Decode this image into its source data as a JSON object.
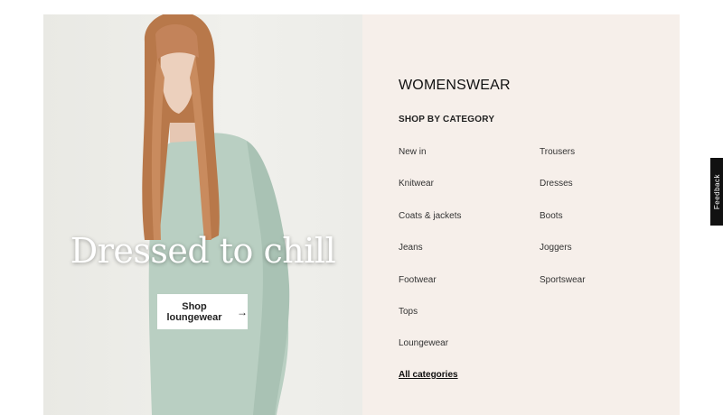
{
  "hero": {
    "title": "Dressed to chill",
    "button_label": "Shop loungewear",
    "button_icon": "arrow-right-icon"
  },
  "menu": {
    "title": "WOMENSWEAR",
    "subtitle": "SHOP BY CATEGORY",
    "left_categories": [
      "New in",
      "Knitwear",
      "Coats & jackets",
      "Jeans",
      "Footwear",
      "Tops",
      "Loungewear"
    ],
    "right_categories": [
      "Trousers",
      "Dresses",
      "Boots",
      "Joggers",
      "Sportswear"
    ],
    "all_categories": "All categories"
  },
  "feedback_label": "Feedback",
  "colors": {
    "menu_bg": "#f6efea",
    "hero_bg": "#ecece8",
    "sweater": "#b7cdc0",
    "hair": "#b8784a"
  }
}
